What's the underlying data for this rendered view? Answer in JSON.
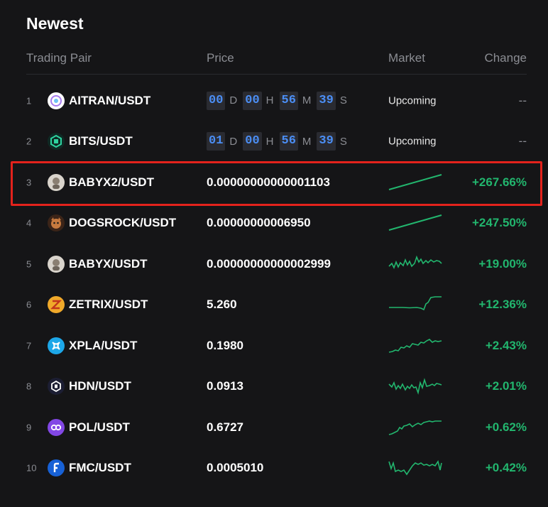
{
  "title": "Newest",
  "headers": {
    "pair": "Trading Pair",
    "price": "Price",
    "market": "Market",
    "change": "Change"
  },
  "colors": {
    "positive": "#22b66e",
    "countdown": "#4b8ef5",
    "highlight": "#e3221c"
  },
  "rows": [
    {
      "index": "1",
      "pair": "AITRAN/USDT",
      "icon": "aitran-coin-icon",
      "countdown": {
        "d": "00",
        "h": "00",
        "m": "56",
        "s": "39",
        "d_unit": "D",
        "h_unit": "H",
        "m_unit": "M",
        "s_unit": "S"
      },
      "market": "Upcoming",
      "change": "--"
    },
    {
      "index": "2",
      "pair": "BITS/USDT",
      "icon": "bits-coin-icon",
      "countdown": {
        "d": "01",
        "h": "00",
        "m": "56",
        "s": "39",
        "d_unit": "D",
        "h_unit": "H",
        "m_unit": "M",
        "s_unit": "S"
      },
      "market": "Upcoming",
      "change": "--"
    },
    {
      "index": "3",
      "pair": "BABYX2/USDT",
      "icon": "babyx2-coin-icon",
      "price": "0.00000000000001103",
      "spark": "linear-up",
      "change": "+267.66%"
    },
    {
      "index": "4",
      "pair": "DOGSROCK/USDT",
      "icon": "dogsrock-coin-icon",
      "price": "0.00000000006950",
      "spark": "linear-up",
      "change": "+247.50%"
    },
    {
      "index": "5",
      "pair": "BABYX/USDT",
      "icon": "babyx-coin-icon",
      "price": "0.00000000000002999",
      "spark": "volatile",
      "change": "+19.00%"
    },
    {
      "index": "6",
      "pair": "ZETRIX/USDT",
      "icon": "zetrix-coin-icon",
      "price": "5.260",
      "spark": "flat-jump",
      "change": "+12.36%"
    },
    {
      "index": "7",
      "pair": "XPLA/USDT",
      "icon": "xpla-coin-icon",
      "price": "0.1980",
      "spark": "rising-wave",
      "change": "+2.43%"
    },
    {
      "index": "8",
      "pair": "HDN/USDT",
      "icon": "hdn-coin-icon",
      "price": "0.0913",
      "spark": "volatile",
      "change": "+2.01%"
    },
    {
      "index": "9",
      "pair": "POL/USDT",
      "icon": "pol-coin-icon",
      "price": "0.6727",
      "spark": "rising-wave",
      "change": "+0.62%"
    },
    {
      "index": "10",
      "pair": "FMC/USDT",
      "icon": "fmc-coin-icon",
      "price": "0.0005010",
      "spark": "flat-volatile",
      "change": "+0.42%"
    }
  ]
}
